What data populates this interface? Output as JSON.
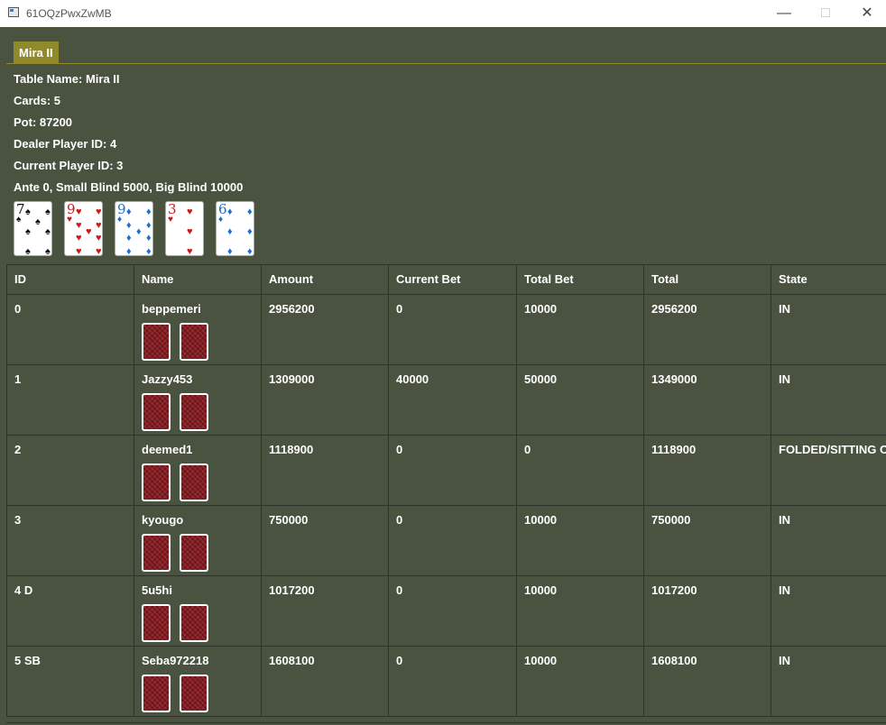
{
  "window": {
    "title": "61OQzPwxZwMB",
    "controls": [
      "minimize-icon",
      "maximize-icon",
      "close-icon"
    ]
  },
  "tab": {
    "label": "Mira II"
  },
  "info": {
    "table_name": "Table Name: Mira II",
    "cards": "Cards: 5",
    "pot": "Pot: 87200",
    "dealer": "Dealer Player ID: 4",
    "current": "Current Player ID: 3",
    "blinds": "Ante 0, Small Blind 5000, Big Blind 10000"
  },
  "board": [
    {
      "rank": "7",
      "suit": "♠",
      "color": "black"
    },
    {
      "rank": "9",
      "suit": "♥",
      "color": "red"
    },
    {
      "rank": "9",
      "suit": "♦",
      "color": "blue"
    },
    {
      "rank": "3",
      "suit": "♥",
      "color": "red"
    },
    {
      "rank": "6",
      "suit": "♦",
      "color": "blue"
    }
  ],
  "columns": [
    "ID",
    "Name",
    "Amount",
    "Current Bet",
    "Total Bet",
    "Total",
    "State"
  ],
  "players": [
    {
      "id": "0",
      "name": "beppemeri",
      "amount": "2956200",
      "current_bet": "0",
      "total_bet": "10000",
      "total": "2956200",
      "state": "IN"
    },
    {
      "id": "1",
      "name": "Jazzy453",
      "amount": "1309000",
      "current_bet": "40000",
      "total_bet": "50000",
      "total": "1349000",
      "state": "IN"
    },
    {
      "id": "2",
      "name": "deemed1",
      "amount": "1118900",
      "current_bet": "0",
      "total_bet": "0",
      "total": "1118900",
      "state": "FOLDED/SITTING O"
    },
    {
      "id": "3",
      "name": "kyougo",
      "amount": "750000",
      "current_bet": "0",
      "total_bet": "10000",
      "total": "750000",
      "state": "IN"
    },
    {
      "id": "4 D",
      "name": "5u5hi",
      "amount": "1017200",
      "current_bet": "0",
      "total_bet": "10000",
      "total": "1017200",
      "state": "IN"
    },
    {
      "id": "5 SB",
      "name": "Seba972218",
      "amount": "1608100",
      "current_bet": "0",
      "total_bet": "10000",
      "total": "1608100",
      "state": "IN"
    }
  ]
}
